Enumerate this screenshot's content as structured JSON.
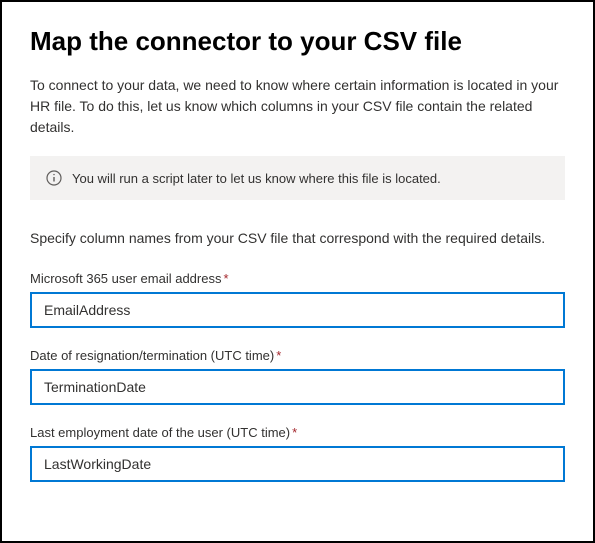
{
  "title": "Map the connector to your CSV file",
  "intro": "To connect to your data, we need to know where certain information is located in your HR file. To do this, let us know which columns in your CSV file contain the related details.",
  "banner": {
    "text": "You will run a script later to let us know where this file is located."
  },
  "sectionText": "Specify column names from your CSV file that correspond with the required details.",
  "fields": [
    {
      "label": "Microsoft 365 user email address",
      "required": true,
      "value": "EmailAddress"
    },
    {
      "label": "Date of resignation/termination (UTC time)",
      "required": true,
      "value": "TerminationDate"
    },
    {
      "label": "Last employment date of the user (UTC time)",
      "required": true,
      "value": "LastWorkingDate"
    }
  ]
}
